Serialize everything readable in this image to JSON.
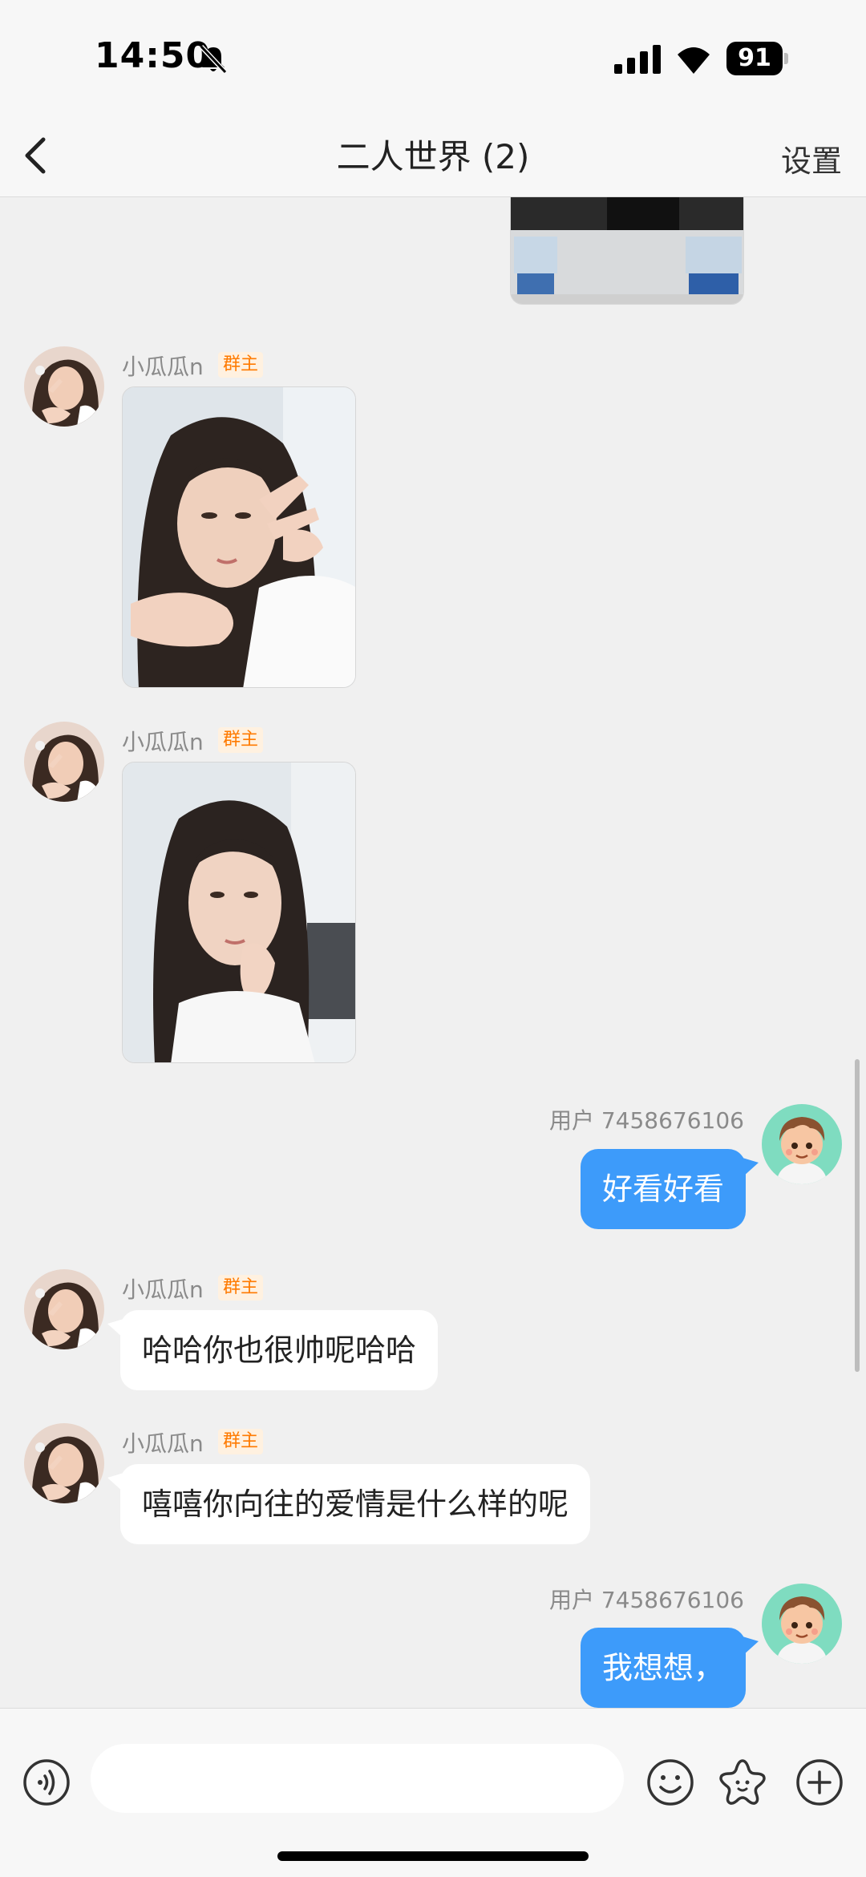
{
  "status_bar": {
    "time": "14:50",
    "battery": "91"
  },
  "nav": {
    "title": "二人世界 (2)",
    "settings_label": "设置"
  },
  "messages": [
    {
      "type": "image",
      "direction": "out",
      "content": "photo-partial"
    },
    {
      "type": "image",
      "direction": "in",
      "sender": "小瓜瓜n",
      "badge": "群主",
      "content": "selfie-peace-sign"
    },
    {
      "type": "image",
      "direction": "in",
      "sender": "小瓜瓜n",
      "badge": "群主",
      "content": "selfie-hand-on-chin"
    },
    {
      "type": "text",
      "direction": "out",
      "sender": "用户 7458676106",
      "text": "好看好看"
    },
    {
      "type": "text",
      "direction": "in",
      "sender": "小瓜瓜n",
      "badge": "群主",
      "text": "哈哈你也很帅呢哈哈"
    },
    {
      "type": "text",
      "direction": "in",
      "sender": "小瓜瓜n",
      "badge": "群主",
      "text": "嘻嘻你向往的爱情是什么样的呢"
    },
    {
      "type": "text",
      "direction": "out",
      "sender": "用户 7458676106",
      "text": "我想想，"
    }
  ],
  "input": {
    "placeholder": ""
  },
  "colors": {
    "outgoing_bubble": "#3d9bfa",
    "incoming_bubble": "#ffffff",
    "badge_text": "#ff7a00",
    "background": "#f0f0f0"
  },
  "icons": [
    "mute-icon",
    "signal-icon",
    "wifi-icon",
    "back-icon",
    "voice-icon",
    "emoji-icon",
    "sticker-icon",
    "plus-icon"
  ]
}
